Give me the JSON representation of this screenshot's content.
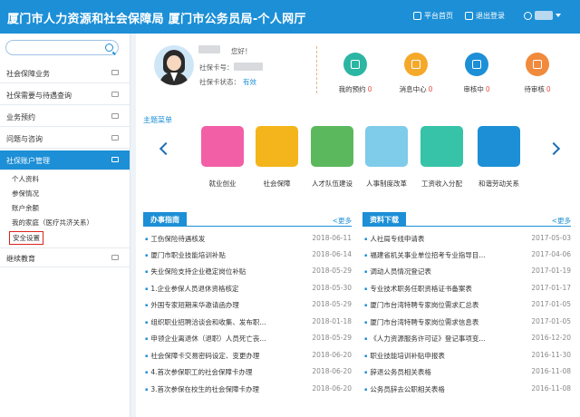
{
  "header": {
    "title": "厦门市人力资源和社会保障局 厦门市公务员局-个人网厅",
    "home_label": "平台首页",
    "logout_label": "退出登录"
  },
  "search": {
    "placeholder": ""
  },
  "sidebar": {
    "items": [
      {
        "label": "社会保障业务"
      },
      {
        "label": "社保需要与待遇查询"
      },
      {
        "label": "业务预约"
      },
      {
        "label": "问题与咨询"
      },
      {
        "label": "社保账户管理"
      },
      {
        "label": "继续教育"
      }
    ],
    "subitems": [
      {
        "label": "个人资料"
      },
      {
        "label": "参保情况"
      },
      {
        "label": "账户余额"
      },
      {
        "label": "我的家庭（医疗共济关系）"
      },
      {
        "label": "安全设置"
      }
    ]
  },
  "profile": {
    "greeting": "您好！",
    "card_no_label": "社保卡号：",
    "card_status_label": "社保卡状态：",
    "card_status_value": "有效"
  },
  "stats": [
    {
      "label": "我的预约",
      "count": "0",
      "color": "#2bb6a3",
      "icon": "phone-icon"
    },
    {
      "label": "消息中心",
      "count": "0",
      "color": "#f4a92a",
      "icon": "mail-icon"
    },
    {
      "label": "审核中",
      "count": "0",
      "color": "#1c8fd6",
      "icon": "calendar-icon"
    },
    {
      "label": "待审核",
      "count": "0",
      "color": "#f08a3c",
      "icon": "clipboard-icon"
    }
  ],
  "themes": {
    "title": "主题菜单",
    "items": [
      {
        "label": "就业创业",
        "color": "#f25fa6",
        "icon": "smile-icon"
      },
      {
        "label": "社会保障",
        "color": "#f3b51b",
        "icon": "graduation-cap-icon"
      },
      {
        "label": "人才队伍建设",
        "color": "#5cb85c",
        "icon": "briefcase-icon"
      },
      {
        "label": "人事制度改革",
        "color": "#7ecbea",
        "icon": "id-card-icon"
      },
      {
        "label": "工资收入分配",
        "color": "#36c3a8",
        "icon": "lightbulb-icon"
      },
      {
        "label": "和谐劳动关系",
        "color": "#1c8fd6",
        "icon": "bank-card-icon"
      }
    ]
  },
  "guide": {
    "title": "办事指南",
    "more": "<更多",
    "items": [
      {
        "title": "工伤保险待遇核发",
        "date": "2018-06-11"
      },
      {
        "title": "厦门市职业技能培训补贴",
        "date": "2018-06-14"
      },
      {
        "title": "失业保险支持企业稳定岗位补贴",
        "date": "2018-05-29"
      },
      {
        "title": "1.企业参保人员退休资格核定",
        "date": "2018-05-30"
      },
      {
        "title": "外国专家短期来华邀请函办理",
        "date": "2018-05-29"
      },
      {
        "title": "组织职业招聘洽谈会和收集、发布职...",
        "date": "2018-01-18"
      },
      {
        "title": "申领企业离退休（退职）人员死亡丧...",
        "date": "2018-05-29"
      },
      {
        "title": "社会保障卡交易密码设定、变更办理",
        "date": "2018-06-20"
      },
      {
        "title": "4.首次参保职工的社会保障卡办理",
        "date": "2018-06-20"
      },
      {
        "title": "3.首次参保在校生的社会保障卡办理",
        "date": "2018-06-20"
      }
    ]
  },
  "downloads": {
    "title": "资料下载",
    "more": "<更多",
    "items": [
      {
        "title": "人社局专线申请表",
        "date": "2017-05-03"
      },
      {
        "title": "福建省机关事业单位招考专业指导目...",
        "date": "2017-04-06"
      },
      {
        "title": "调动人员情况登记表",
        "date": "2017-01-19"
      },
      {
        "title": "专业技术职务任职资格证书备案表",
        "date": "2017-01-17"
      },
      {
        "title": "厦门市台湾特聘专家岗位需求汇总表",
        "date": "2017-01-05"
      },
      {
        "title": "厦门市台湾特聘专家岗位需求信息表",
        "date": "2017-01-05"
      },
      {
        "title": "《人力资源服务许可证》登记事项变...",
        "date": "2016-12-20"
      },
      {
        "title": "职业技能培训补贴申报表",
        "date": "2016-11-30"
      },
      {
        "title": "辞退公务员相关表格",
        "date": "2016-11-08"
      },
      {
        "title": "公务员辞去公职相关表格",
        "date": "2016-11-08"
      }
    ]
  }
}
